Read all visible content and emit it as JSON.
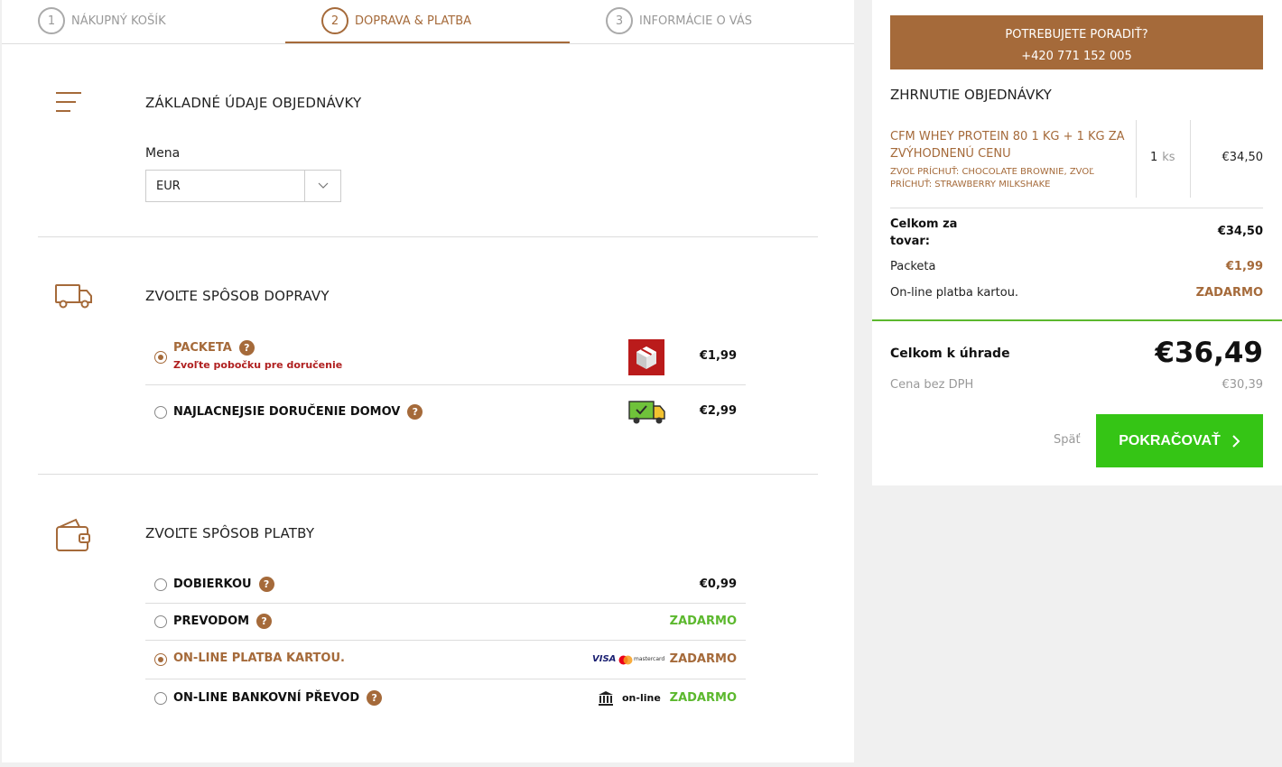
{
  "steps": [
    {
      "num": "1",
      "label": "NÁKUPNÝ KOŠÍK"
    },
    {
      "num": "2",
      "label": "DOPRAVA & PLATBA"
    },
    {
      "num": "3",
      "label": "INFORMÁCIE O VÁS"
    }
  ],
  "basic": {
    "title": "ZÁKLADNÉ ÚDAJE OBJEDNÁVKY",
    "currency_label": "Mena",
    "currency_value": "EUR"
  },
  "shipping": {
    "title": "ZVOĽTE SPÔSOB DOPRAVY",
    "options": [
      {
        "name": "PACKETA",
        "note": "Zvoľte pobočku pre doručenie",
        "price": "€1,99",
        "selected": true
      },
      {
        "name": "NAJLACNEJSIE DORUČENIE DOMOV",
        "price": "€2,99",
        "selected": false
      }
    ]
  },
  "payment": {
    "title": "ZVOĽTE SPÔSOB PLATBY",
    "options": [
      {
        "name": "DOBIERKOU",
        "price": "€0,99"
      },
      {
        "name": "PREVODOM",
        "price": "ZADARMO"
      },
      {
        "name": "ON-LINE PLATBA KARTOU.",
        "price": "ZADARMO",
        "selected": true
      },
      {
        "name": "ON-LINE BANKOVNÍ PŘEVOD",
        "price": "ZADARMO"
      }
    ],
    "visa_label": "VISA",
    "mastercard_label": "mastercard",
    "online_label": "on-line"
  },
  "help_glyph": "?",
  "sidebar": {
    "advice_line1": "POTREBUJETE PORADIŤ?",
    "advice_line2": "+420 771 152 005",
    "summary_title": "ZHRNUTIE OBJEDNÁVKY",
    "item": {
      "name": "CFM WHEY PROTEIN 80 1 KG + 1 KG ZA ZVÝHODNENÚ CENU",
      "variant": "ZVOĽ PRÍCHUŤ: CHOCOLATE BROWNIE, ZVOĽ PRÍCHUŤ: STRAWBERRY MILKSHAKE",
      "qty": "1",
      "unit": "ks",
      "price": "€34,50"
    },
    "goods_total_label": "Celkom za tovar:",
    "goods_total_value": "€34,50",
    "shipping_label": "Packeta",
    "shipping_value": "€1,99",
    "payment_label": "On-line platba kartou.",
    "payment_value": "ZADARMO",
    "to_pay_label": "Celkom k úhrade",
    "to_pay_value": "€36,49",
    "no_vat_label": "Cena bez DPH",
    "no_vat_value": "€30,39",
    "back_label": "Späť",
    "continue_label": "POKRAČOVAŤ"
  },
  "colors": {
    "accent": "#a56a3a",
    "green": "#35c515",
    "free": "#5cb82e",
    "error": "#b02020"
  }
}
